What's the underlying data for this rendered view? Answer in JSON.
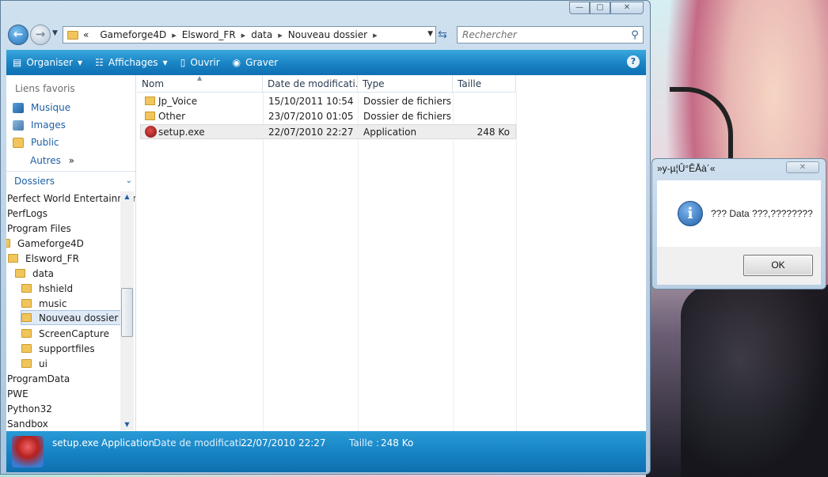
{
  "window": {
    "caption_min": "—",
    "caption_max": "▢",
    "caption_close": "✕"
  },
  "navigation": {
    "back": "←",
    "forward": "→",
    "breadcrumb_prefix": "«",
    "breadcrumb": [
      "Gameforge4D",
      "Elsword_FR",
      "data",
      "Nouveau dossier"
    ],
    "search_placeholder": "Rechercher"
  },
  "toolbar": {
    "organize": "Organiser",
    "views": "Affichages",
    "open": "Ouvrir",
    "burn": "Graver",
    "help": "?"
  },
  "sidebar": {
    "favorites_title": "Liens favoris",
    "favorites": [
      {
        "label": "Musique",
        "icon": "music-library-icon"
      },
      {
        "label": "Images",
        "icon": "pictures-library-icon"
      },
      {
        "label": "Public",
        "icon": "folder-icon"
      }
    ],
    "more": "Autres",
    "more_glyph": "»",
    "folders_title": "Dossiers",
    "tree": [
      {
        "label": "Perfect World Entertainmer",
        "folder": false
      },
      {
        "label": "PerfLogs",
        "folder": false
      },
      {
        "label": "Program Files",
        "folder": false
      },
      {
        "label": "Gameforge4D",
        "folder": true
      },
      {
        "label": "Elsword_FR",
        "folder": true
      },
      {
        "label": "data",
        "folder": true
      },
      {
        "label": "hshield",
        "folder": true
      },
      {
        "label": "music",
        "folder": true
      },
      {
        "label": "Nouveau dossier",
        "folder": true,
        "selected": true
      },
      {
        "label": "ScreenCapture",
        "folder": true
      },
      {
        "label": "supportfiles",
        "folder": true
      },
      {
        "label": "ui",
        "folder": true
      },
      {
        "label": "ProgramData",
        "folder": false
      },
      {
        "label": "PWE",
        "folder": false
      },
      {
        "label": "Python32",
        "folder": false
      },
      {
        "label": "Sandbox",
        "folder": false
      }
    ]
  },
  "file_list": {
    "columns": [
      "Nom",
      "Date de modificati...",
      "Type",
      "Taille"
    ],
    "rows": [
      {
        "name": "Jp_Voice",
        "date": "15/10/2011 10:54",
        "type": "Dossier de fichiers",
        "size": "",
        "icon": "folder-icon"
      },
      {
        "name": "Other",
        "date": "23/07/2010 01:05",
        "type": "Dossier de fichiers",
        "size": "",
        "icon": "folder-icon"
      },
      {
        "name": "setup.exe",
        "date": "22/07/2010 22:27",
        "type": "Application",
        "size": "248 Ko",
        "icon": "app-icon"
      }
    ]
  },
  "details": {
    "name": "setup.exe",
    "type": "Application",
    "date_label": "Date de modificati...",
    "date_value": "22/07/2010 22:27",
    "size_label": "Taille :",
    "size_value": "248 Ko"
  },
  "dialog": {
    "title": "»y-µ¦Û°ÊÅà´«",
    "message": "??? Data ???,????????",
    "ok": "OK",
    "close": "✕"
  }
}
